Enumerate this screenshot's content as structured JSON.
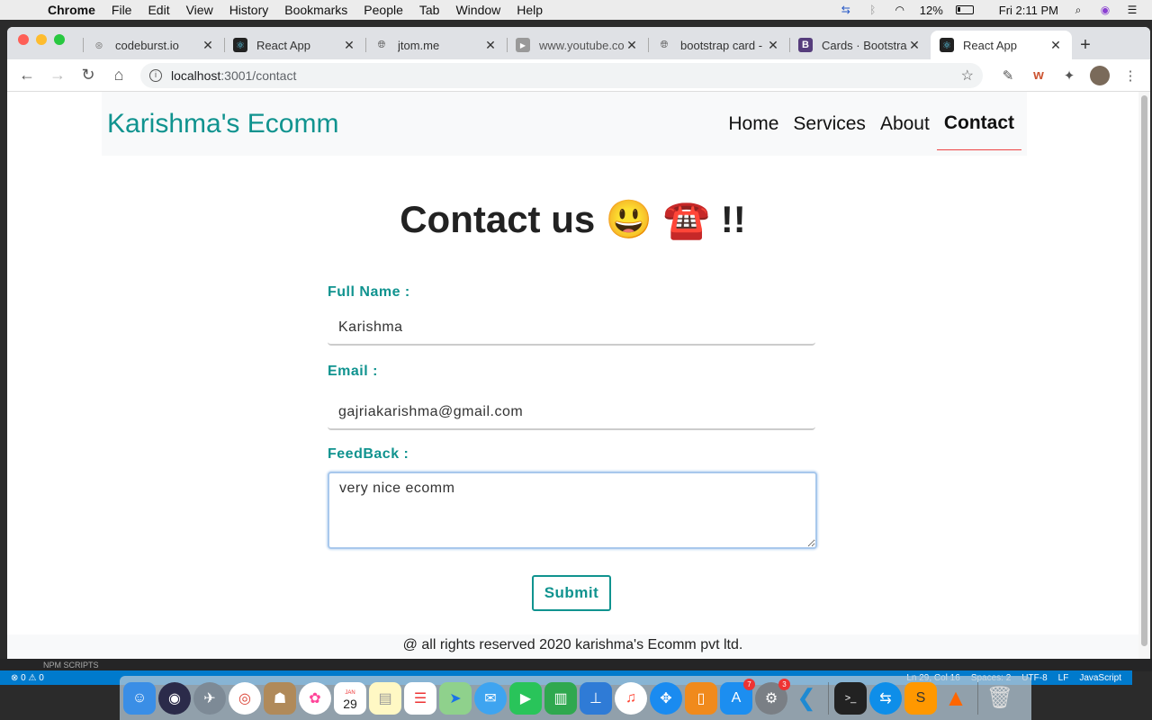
{
  "menubar": {
    "app_name": "Chrome",
    "items": [
      "File",
      "Edit",
      "View",
      "History",
      "Bookmarks",
      "People",
      "Tab",
      "Window",
      "Help"
    ],
    "battery": "12%",
    "clock": "Fri 2:11 PM"
  },
  "tabs": [
    {
      "title": "codeburst.io",
      "icon": "codeburst-icon"
    },
    {
      "title": "React App",
      "icon": "react-icon"
    },
    {
      "title": "jtom.me",
      "icon": "globe-icon"
    },
    {
      "title": "www.youtube.co",
      "icon": "youtube-icon"
    },
    {
      "title": "bootstrap card -",
      "icon": "globe-icon"
    },
    {
      "title": "Cards · Bootstra",
      "icon": "bootstrap-icon"
    },
    {
      "title": "React App",
      "icon": "react-icon",
      "active": true
    }
  ],
  "address": {
    "host": "localhost",
    "path": ":3001/contact"
  },
  "site": {
    "brand": "Karishma's Ecomm",
    "nav": [
      "Home",
      "Services",
      "About",
      "Contact"
    ],
    "active_nav": "Contact"
  },
  "contact": {
    "heading": "Contact us 😃 ☎️ !!",
    "name_label": "Full Name :",
    "name_value": "Karishma",
    "email_label": "Email :",
    "email_value": "gajriakarishma@gmail.com",
    "feedback_label": "FeedBack :",
    "feedback_value": "very nice ecomm",
    "submit_label": "Submit"
  },
  "footer": {
    "text": "@ all rights reserved 2020 karishma's Ecomm pvt ltd."
  },
  "vscode": {
    "npm_scripts": "NPM SCRIPTS",
    "status_left": "⊗ 0 ⚠ 0",
    "status_right": [
      "Ln 29, Col 16",
      "Spaces: 2",
      "UTF-8",
      "LF",
      "JavaScript"
    ]
  },
  "dock": {
    "appstore_badge": "7",
    "settings_badge": "3",
    "calendar_month": "JAN",
    "calendar_day": "29"
  },
  "colors": {
    "accent": "#10938f",
    "nav_active_underline": "#ee4444",
    "statusbar": "#007acc"
  }
}
